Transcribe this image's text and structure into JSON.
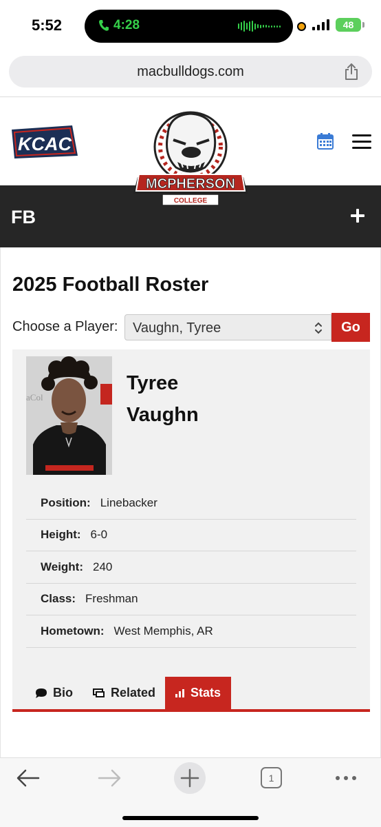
{
  "status_bar": {
    "time": "5:52",
    "call_duration": "4:28",
    "battery": "48"
  },
  "browser": {
    "url": "macbulldogs.com",
    "open_tabs": "1"
  },
  "site": {
    "conference_logo": "KCAC",
    "school_logo": {
      "name": "MCPHERSON",
      "subtitle": "COLLEGE"
    },
    "sport": "FB"
  },
  "roster": {
    "title": "2025 Football Roster",
    "choose_label": "Choose a Player:",
    "selected_player": "Vaughn, Tyree",
    "go_label": "Go"
  },
  "player": {
    "first_name": "Tyree",
    "last_name": "Vaughn",
    "details": [
      {
        "label": "Position:",
        "value": "Linebacker"
      },
      {
        "label": "Height:",
        "value": "6-0"
      },
      {
        "label": "Weight:",
        "value": "240"
      },
      {
        "label": "Class:",
        "value": "Freshman"
      },
      {
        "label": "Hometown:",
        "value": "West Memphis, AR"
      }
    ]
  },
  "tabs": [
    {
      "label": "Bio",
      "icon": "comment-icon"
    },
    {
      "label": "Related",
      "icon": "related-icon"
    },
    {
      "label": "Stats",
      "icon": "bar-chart-icon",
      "active": true
    }
  ],
  "colors": {
    "accent": "#c7261f",
    "header_bar": "#262626",
    "card_bg": "#f1f1f1"
  }
}
